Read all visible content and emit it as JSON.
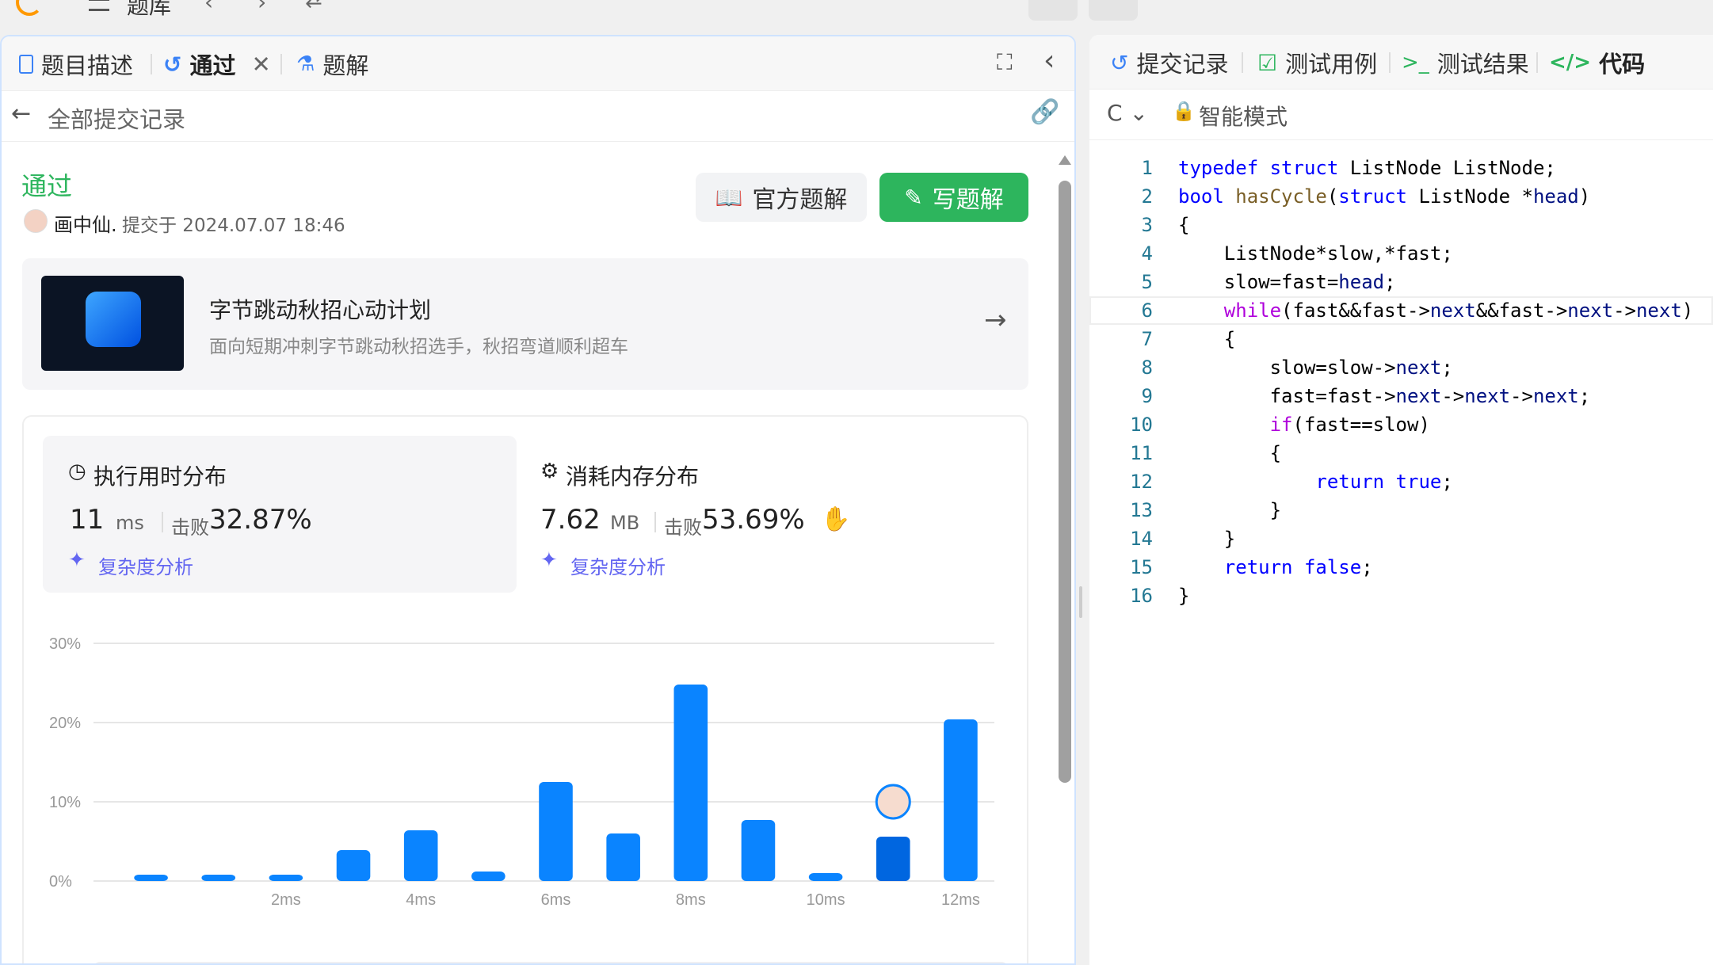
{
  "topbar": {
    "title": "题库"
  },
  "left": {
    "tabs": [
      {
        "label": "题目描述"
      },
      {
        "label": "通过"
      },
      {
        "label": "题解"
      }
    ],
    "back_label": "全部提交记录",
    "status": "通过",
    "user": "画中仙.",
    "submitted_text": "提交于 2024.07.07 18:46",
    "btn_official": "官方题解",
    "btn_write": "写题解",
    "promo": {
      "title": "字节跳动秋招心动计划",
      "subtitle": "面向短期冲刺字节跳动秋招选手，秋招弯道顺利超车"
    },
    "runtime": {
      "label": "执行用时分布",
      "value": "11",
      "unit": "ms",
      "beat_label": "击败",
      "beat_value": "32.87%",
      "analysis": "复杂度分析"
    },
    "memory": {
      "label": "消耗内存分布",
      "value": "7.62",
      "unit": "MB",
      "beat_label": "击败",
      "beat_value": "53.69%",
      "analysis": "复杂度分析"
    }
  },
  "chart_data": {
    "type": "bar",
    "x": [
      1,
      2,
      3,
      4,
      5,
      6,
      7,
      8,
      9,
      10,
      11,
      12,
      13
    ],
    "categories": [
      "",
      "",
      "2ms",
      "",
      "4ms",
      "",
      "6ms",
      "",
      "8ms",
      "",
      "10ms",
      "",
      "12ms"
    ],
    "values": [
      0.8,
      0.8,
      0.8,
      3.9,
      6.4,
      1.2,
      12.5,
      6.0,
      24.8,
      7.7,
      1.0,
      5.6,
      20.4
    ],
    "highlight_index": 11,
    "ylim": [
      0,
      30
    ],
    "yticks": [
      "0%",
      "10%",
      "20%",
      "30%"
    ],
    "grid": true,
    "color": "#0a84ff",
    "highlight_color": "#0066e0"
  },
  "right": {
    "tabs": [
      {
        "label": "提交记录"
      },
      {
        "label": "测试用例"
      },
      {
        "label": "测试结果"
      },
      {
        "label": "代码"
      }
    ],
    "lang": "C",
    "mode": "智能模式",
    "code_lines": [
      "typedef struct ListNode ListNode;",
      "bool hasCycle(struct ListNode *head)",
      "{",
      "    ListNode*slow,*fast;",
      "    slow=fast=head;",
      "    while(fast&&fast->next&&fast->next->next)",
      "    {",
      "        slow=slow->next;",
      "        fast=fast->next->next->next;",
      "        if(fast==slow)",
      "        {",
      "            return true;",
      "        }",
      "    }",
      "    return false;",
      "}"
    ]
  }
}
